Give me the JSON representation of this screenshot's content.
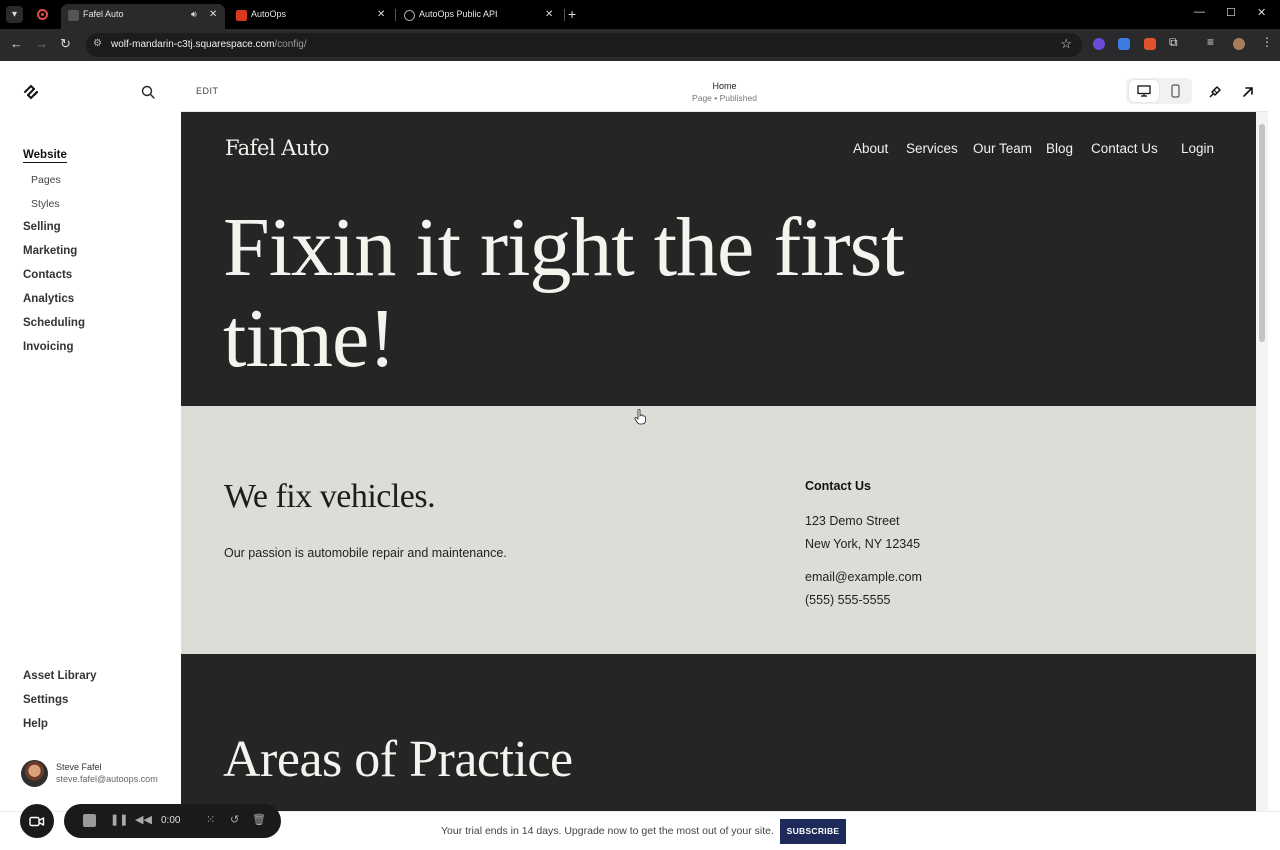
{
  "browser": {
    "tabs": [
      {
        "title": "Fafel Auto",
        "active": true
      },
      {
        "title": "AutoOps",
        "active": false
      },
      {
        "title": "AutoOps Public API",
        "active": false
      }
    ],
    "url_host": "wolf-mandarin-c3tj.squarespace.com",
    "url_path": "/config/"
  },
  "sidebar": {
    "items": [
      {
        "label": "Website",
        "active": true
      },
      {
        "label": "Selling"
      },
      {
        "label": "Marketing"
      },
      {
        "label": "Contacts"
      },
      {
        "label": "Analytics"
      },
      {
        "label": "Scheduling"
      },
      {
        "label": "Invoicing"
      }
    ],
    "sub_items": [
      "Pages",
      "Styles"
    ],
    "bottom_items": [
      "Asset Library",
      "Settings",
      "Help"
    ],
    "user": {
      "name": "Steve Fafel",
      "email": "steve.fafel@autoops.com"
    }
  },
  "editor": {
    "edit_label": "EDIT",
    "page_title": "Home",
    "page_status": "Page • Published"
  },
  "site": {
    "logo": "Fafel Auto",
    "nav": [
      "About",
      "Services",
      "Our Team",
      "Blog",
      "Contact Us"
    ],
    "login": "Login",
    "hero_heading": "Fixin it right the first time!",
    "about_heading": "We fix vehicles.",
    "about_text": "Our passion is automobile repair and maintenance.",
    "contact_heading": "Contact Us",
    "contact_address_1": "123 Demo Street",
    "contact_address_2": "New York, NY 12345",
    "contact_email": "email@example.com",
    "contact_phone": "(555) 555-5555",
    "practice_heading": "Areas of Practice"
  },
  "trial": {
    "text": "Your trial ends in 14 days. Upgrade now to get the most out of your site.",
    "button": "SUBSCRIBE"
  },
  "recorder": {
    "time": "0:00"
  },
  "colors": {
    "hero_bg": "#262526",
    "about_bg": "#dddcd7",
    "subscribe_bg": "#1e2a5a"
  }
}
